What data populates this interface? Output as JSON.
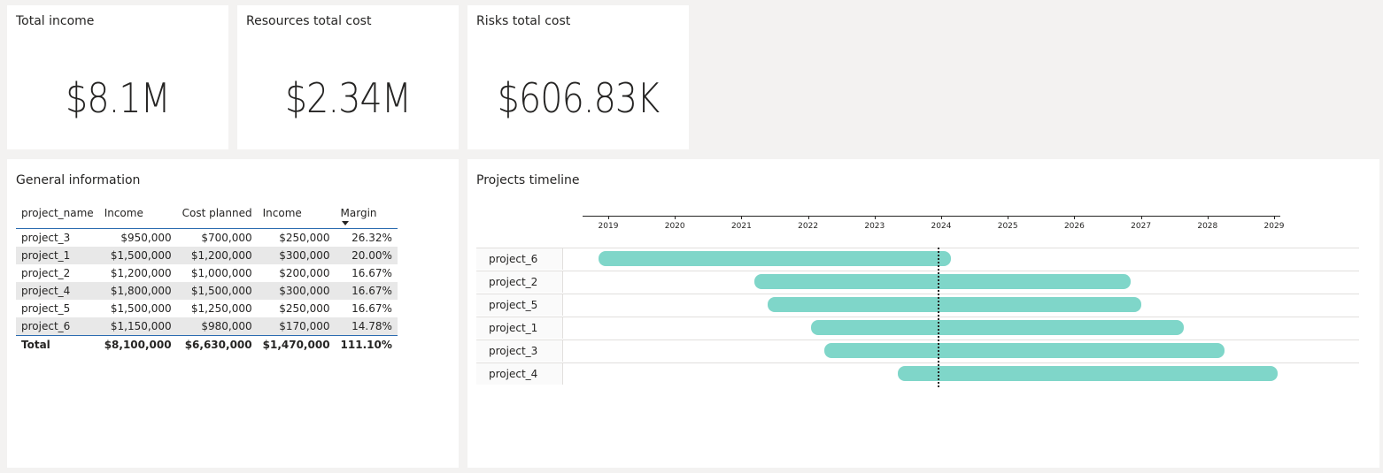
{
  "kpis": [
    {
      "title": "Total income",
      "value": "$8.1M"
    },
    {
      "title": "Resources total cost",
      "value": "$2.34M"
    },
    {
      "title": "Risks total cost",
      "value": "$606.83K"
    }
  ],
  "general_info": {
    "title": "General information",
    "columns": [
      "project_name",
      "Income",
      "Cost planned",
      "Income",
      "Margin"
    ],
    "sorted_column": "Margin",
    "rows": [
      [
        "project_3",
        "$950,000",
        "$700,000",
        "$250,000",
        "26.32%"
      ],
      [
        "project_1",
        "$1,500,000",
        "$1,200,000",
        "$300,000",
        "20.00%"
      ],
      [
        "project_2",
        "$1,200,000",
        "$1,000,000",
        "$200,000",
        "16.67%"
      ],
      [
        "project_4",
        "$1,800,000",
        "$1,500,000",
        "$300,000",
        "16.67%"
      ],
      [
        "project_5",
        "$1,500,000",
        "$1,250,000",
        "$250,000",
        "16.67%"
      ],
      [
        "project_6",
        "$1,150,000",
        "$980,000",
        "$170,000",
        "14.78%"
      ]
    ],
    "total": [
      "Total",
      "$8,100,000",
      "$6,630,000",
      "$1,470,000",
      "111.10%"
    ]
  },
  "timeline": {
    "title": "Projects timeline",
    "accent_color": "#7fd6c9",
    "ticks": [
      "2019",
      "2020",
      "2021",
      "2022",
      "2023",
      "2024",
      "2025",
      "2026",
      "2027",
      "2028",
      "2029"
    ],
    "today_marker": 2023.95
  },
  "chart_data": {
    "type": "gantt",
    "title": "Projects timeline",
    "x_axis_ticks": [
      2019,
      2020,
      2021,
      2022,
      2023,
      2024,
      2025,
      2026,
      2027,
      2028,
      2029
    ],
    "xlim": [
      2018.6,
      2029.1
    ],
    "reference_line": 2023.95,
    "tasks": [
      {
        "name": "project_6",
        "start": 2018.85,
        "end": 2024.15
      },
      {
        "name": "project_2",
        "start": 2021.2,
        "end": 2026.85
      },
      {
        "name": "project_5",
        "start": 2021.4,
        "end": 2027.0
      },
      {
        "name": "project_1",
        "start": 2022.05,
        "end": 2027.65
      },
      {
        "name": "project_3",
        "start": 2022.25,
        "end": 2028.25
      },
      {
        "name": "project_4",
        "start": 2023.35,
        "end": 2029.05
      }
    ]
  }
}
